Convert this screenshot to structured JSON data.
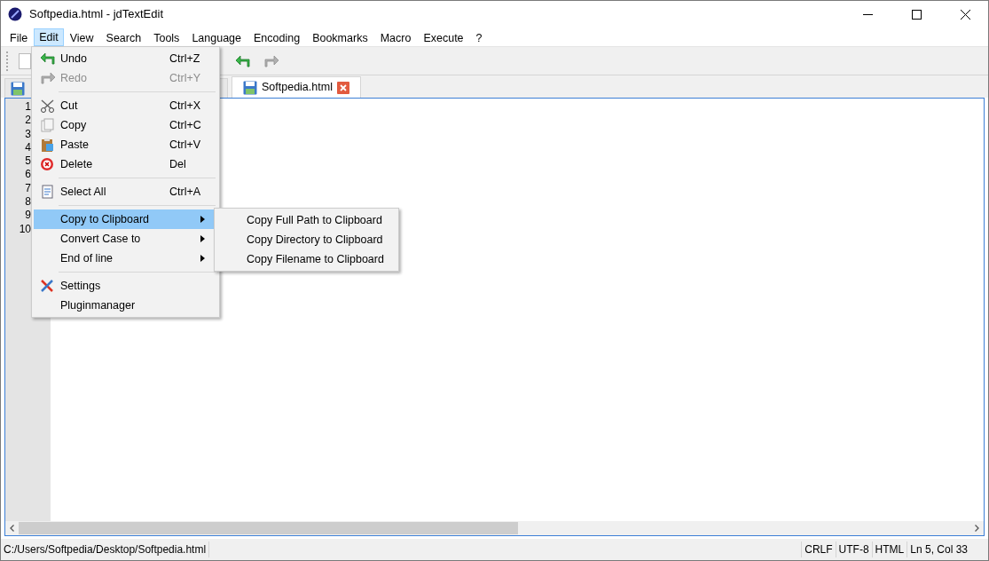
{
  "window": {
    "title": "Softpedia.html - jdTextEdit"
  },
  "menubar": [
    {
      "label": "File",
      "selected": false
    },
    {
      "label": "Edit",
      "selected": true
    },
    {
      "label": "View",
      "selected": false
    },
    {
      "label": "Search",
      "selected": false
    },
    {
      "label": "Tools",
      "selected": false
    },
    {
      "label": "Language",
      "selected": false
    },
    {
      "label": "Encoding",
      "selected": false
    },
    {
      "label": "Bookmarks",
      "selected": false
    },
    {
      "label": "Macro",
      "selected": false
    },
    {
      "label": "Execute",
      "selected": false
    },
    {
      "label": "?",
      "selected": false
    }
  ],
  "tabs": [
    {
      "selected": false
    },
    {
      "label": "Softpedia.html",
      "selected": true
    }
  ],
  "line_numbers": [
    "1",
    "2",
    "3",
    "4",
    "5",
    "6",
    "7",
    "8",
    "9",
    "10"
  ],
  "edit_menu": [
    {
      "kind": "item",
      "label": "Undo",
      "shortcut": "Ctrl+Z",
      "disabled": false,
      "selected": false,
      "submenu": false
    },
    {
      "kind": "item",
      "label": "Redo",
      "shortcut": "Ctrl+Y",
      "disabled": true,
      "selected": false,
      "submenu": false
    },
    {
      "kind": "separator"
    },
    {
      "kind": "item",
      "label": "Cut",
      "shortcut": "Ctrl+X",
      "disabled": false,
      "selected": false,
      "submenu": false
    },
    {
      "kind": "item",
      "label": "Copy",
      "shortcut": "Ctrl+C",
      "disabled": false,
      "selected": false,
      "submenu": false
    },
    {
      "kind": "item",
      "label": "Paste",
      "shortcut": "Ctrl+V",
      "disabled": false,
      "selected": false,
      "submenu": false
    },
    {
      "kind": "item",
      "label": "Delete",
      "shortcut": "Del",
      "disabled": false,
      "selected": false,
      "submenu": false
    },
    {
      "kind": "separator"
    },
    {
      "kind": "item",
      "label": "Select All",
      "shortcut": "Ctrl+A",
      "disabled": false,
      "selected": false,
      "submenu": false
    },
    {
      "kind": "separator"
    },
    {
      "kind": "item",
      "label": "Copy to Clipboard",
      "disabled": false,
      "selected": true,
      "submenu": true
    },
    {
      "kind": "item",
      "label": "Convert Case to",
      "disabled": false,
      "selected": false,
      "submenu": true
    },
    {
      "kind": "item",
      "label": "End of line",
      "disabled": false,
      "selected": false,
      "submenu": true
    },
    {
      "kind": "separator"
    },
    {
      "kind": "item",
      "label": "Settings",
      "disabled": false,
      "selected": false,
      "submenu": false
    },
    {
      "kind": "item",
      "label": "Pluginmanager",
      "disabled": false,
      "selected": false,
      "submenu": false
    }
  ],
  "submenu": [
    "Copy Full Path to Clipboard",
    "Copy Directory to Clipboard",
    "Copy Filename to Clipboard"
  ],
  "status_bar": {
    "path": "C:/Users/Softpedia/Desktop/Softpedia.html",
    "fields": [
      "CRLF",
      "UTF-8",
      "HTML",
      "Ln 5, Col 33"
    ]
  }
}
